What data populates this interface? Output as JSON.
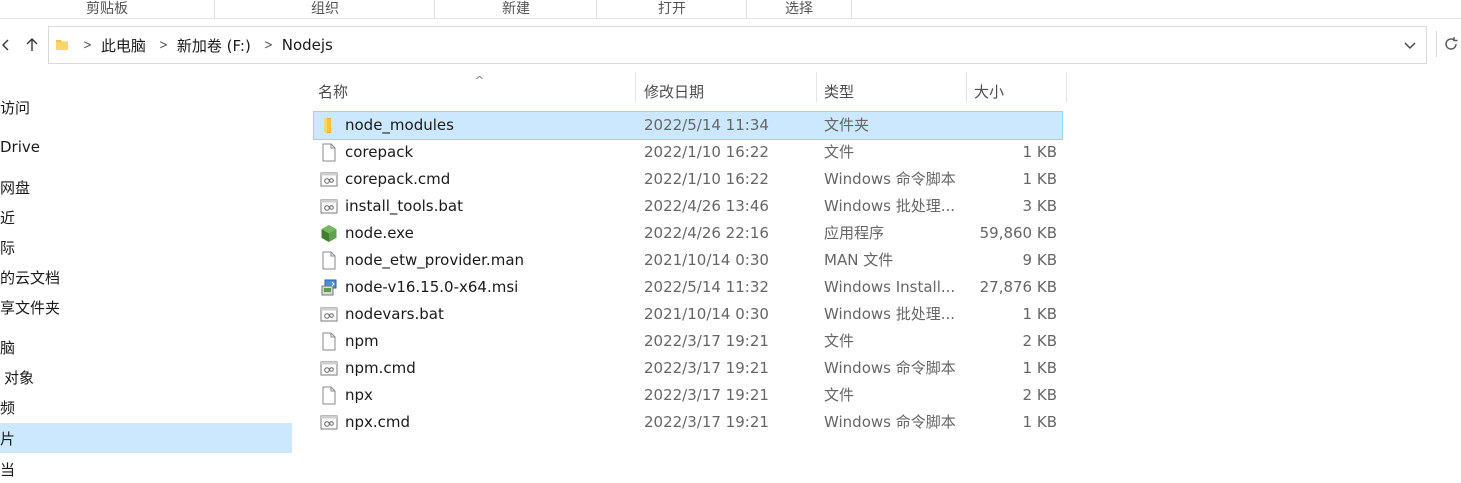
{
  "ribbon": {
    "groups": [
      "剪贴板",
      "组织",
      "新建",
      "打开",
      "选择"
    ]
  },
  "nav": {
    "back_label": "<",
    "up_label": "↑"
  },
  "addressbar": {
    "crumbs": [
      "此电脑",
      "新加卷 (F:)",
      "Nodejs"
    ]
  },
  "sidebar": {
    "items": [
      "访问",
      "Drive",
      "网盘",
      "近",
      "际",
      "的云文档",
      "享文件夹",
      "脑",
      "对象",
      "频",
      "片",
      "当"
    ]
  },
  "columns": {
    "name": "名称",
    "date": "修改日期",
    "type": "类型",
    "size": "大小",
    "sort_indicator": "^"
  },
  "files": [
    {
      "name": "node_modules",
      "date": "2022/5/14 11:34",
      "type": "文件夹",
      "size": "",
      "icon": "folder-icon"
    },
    {
      "name": "corepack",
      "date": "2022/1/10 16:22",
      "type": "文件",
      "size": "1 KB",
      "icon": "file-icon"
    },
    {
      "name": "corepack.cmd",
      "date": "2022/1/10 16:22",
      "type": "Windows 命令脚本",
      "size": "1 KB",
      "icon": "script-icon"
    },
    {
      "name": "install_tools.bat",
      "date": "2022/4/26 13:46",
      "type": "Windows 批处理...",
      "size": "3 KB",
      "icon": "script-icon"
    },
    {
      "name": "node.exe",
      "date": "2022/4/26 22:16",
      "type": "应用程序",
      "size": "59,860 KB",
      "icon": "node-exe-icon"
    },
    {
      "name": "node_etw_provider.man",
      "date": "2021/10/14 0:30",
      "type": "MAN 文件",
      "size": "9 KB",
      "icon": "file-icon"
    },
    {
      "name": "node-v16.15.0-x64.msi",
      "date": "2022/5/14 11:32",
      "type": "Windows Install...",
      "size": "27,876 KB",
      "icon": "installer-icon"
    },
    {
      "name": "nodevars.bat",
      "date": "2021/10/14 0:30",
      "type": "Windows 批处理...",
      "size": "1 KB",
      "icon": "script-icon"
    },
    {
      "name": "npm",
      "date": "2022/3/17 19:21",
      "type": "文件",
      "size": "2 KB",
      "icon": "file-icon"
    },
    {
      "name": "npm.cmd",
      "date": "2022/3/17 19:21",
      "type": "Windows 命令脚本",
      "size": "1 KB",
      "icon": "script-icon"
    },
    {
      "name": "npx",
      "date": "2022/3/17 19:21",
      "type": "文件",
      "size": "2 KB",
      "icon": "file-icon"
    },
    {
      "name": "npx.cmd",
      "date": "2022/3/17 19:21",
      "type": "Windows 命令脚本",
      "size": "1 KB",
      "icon": "script-icon"
    }
  ],
  "colors": {
    "selection": "#cce8ff",
    "selection_border": "#99d1ff",
    "folder": "#f5c542",
    "node_green": "#4f9a3a"
  }
}
